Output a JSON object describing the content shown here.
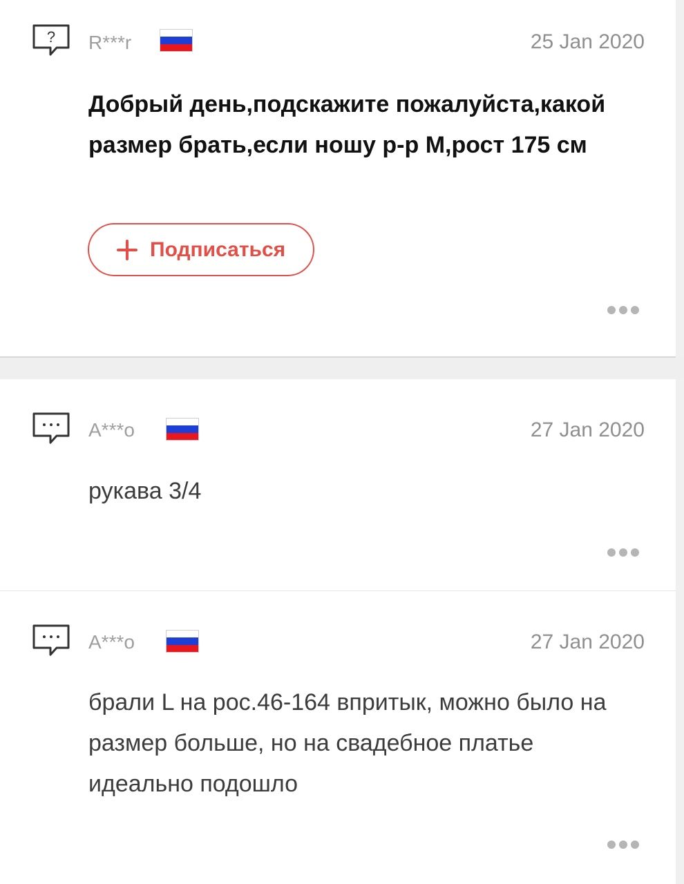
{
  "question": {
    "user": "R***r",
    "date": "25 Jan 2020",
    "text": "Добрый день,подскажите пожалуйста,какой размер брать,если ношу р-р М,рост 175 см",
    "subscribe_label": "Подписаться",
    "icon": "question-bubble-icon",
    "country_flag": "russia-flag-icon"
  },
  "answers": [
    {
      "user": "A***o",
      "date": "27 Jan 2020",
      "text": "рукава 3/4",
      "icon": "answer-bubble-icon",
      "country_flag": "russia-flag-icon"
    },
    {
      "user": "A***o",
      "date": "27 Jan 2020",
      "text": "брали L на рос.46-164 впритык, можно было на размер больше, но на свадебное платье идеально подошло",
      "icon": "answer-bubble-icon",
      "country_flag": "russia-flag-icon"
    }
  ],
  "colors": {
    "accent": "#e34f47",
    "muted_text": "#9e9e9e",
    "separator": "#efefef",
    "flag_white": "#ffffff",
    "flag_blue": "#1d3fd6",
    "flag_red": "#e8161d"
  }
}
